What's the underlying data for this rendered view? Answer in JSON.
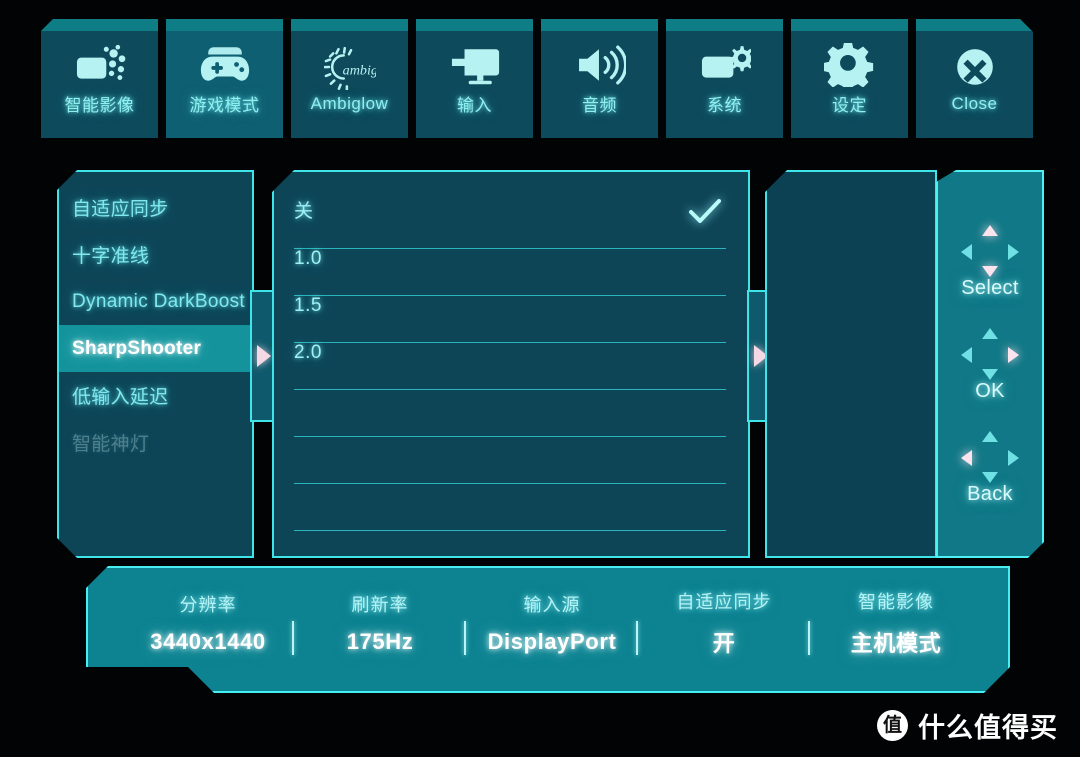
{
  "colors": {
    "accent_cyan": "#3fe3e8",
    "panel_bg": "#0d4557",
    "tab_bg": "#0d4a5c",
    "tab_stripe": "#0f7d85",
    "selected_row": "#14939c",
    "status_bar": "#0d8290",
    "nav_panel": "#107886",
    "highlight_pink": "#fbe4ee",
    "text_cyan": "#7fe9ef",
    "text_white": "#ffffff",
    "disabled_text": "#4d7f8c",
    "background": "#000000"
  },
  "tabbar": {
    "tabs": [
      {
        "label": "智能影像",
        "icon": "smart-image-icon",
        "active": false
      },
      {
        "label": "游戏模式",
        "icon": "gamepad-icon",
        "active": true
      },
      {
        "label": "Ambiglow",
        "icon": "ambiglow-icon",
        "active": false
      },
      {
        "label": "输入",
        "icon": "input-monitor-icon",
        "active": false
      },
      {
        "label": "音频",
        "icon": "speaker-icon",
        "active": false
      },
      {
        "label": "系统",
        "icon": "system-gear-icon",
        "active": false
      },
      {
        "label": "设定",
        "icon": "settings-gear-icon",
        "active": false
      },
      {
        "label": "Close",
        "icon": "close-circle-icon",
        "active": false
      }
    ]
  },
  "left_menu": {
    "items": [
      {
        "label": "自适应同步",
        "state": "normal"
      },
      {
        "label": "十字准线",
        "state": "normal"
      },
      {
        "label": "Dynamic DarkBoost",
        "state": "normal"
      },
      {
        "label": "SharpShooter",
        "state": "selected"
      },
      {
        "label": "低输入延迟",
        "state": "normal"
      },
      {
        "label": "智能神灯",
        "state": "disabled"
      }
    ]
  },
  "options": {
    "rows": [
      {
        "label": "关",
        "checked": true
      },
      {
        "label": "1.0",
        "checked": false
      },
      {
        "label": "1.5",
        "checked": false
      },
      {
        "label": "2.0",
        "checked": false
      },
      {
        "label": "",
        "checked": false
      },
      {
        "label": "",
        "checked": false
      },
      {
        "label": "",
        "checked": false
      }
    ]
  },
  "nav_hints": [
    {
      "label": "Select",
      "highlight": [
        "up",
        "down"
      ]
    },
    {
      "label": "OK",
      "highlight": [
        "right"
      ]
    },
    {
      "label": "Back",
      "highlight": [
        "left"
      ]
    }
  ],
  "status_bar": {
    "cells": [
      {
        "key": "分辨率",
        "value": "3440x1440"
      },
      {
        "key": "刷新率",
        "value": "175Hz"
      },
      {
        "key": "输入源",
        "value": "DisplayPort"
      },
      {
        "key": "自适应同步",
        "value": "开"
      },
      {
        "key": "智能影像",
        "value": "主机模式"
      }
    ]
  },
  "watermark": {
    "logo_char": "值",
    "text": "什么值得买"
  }
}
